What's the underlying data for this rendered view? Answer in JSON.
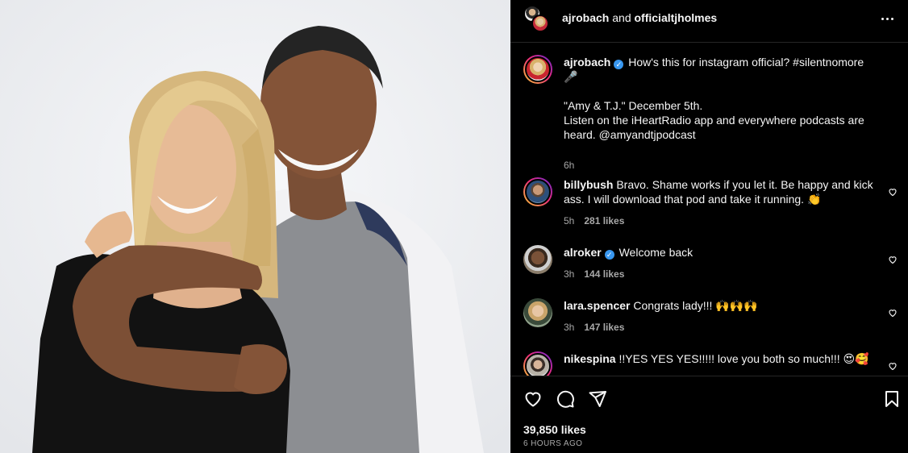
{
  "header": {
    "user1": "ajrobach",
    "conjunction": "and",
    "user2": "officialtjholmes"
  },
  "caption": {
    "username": "ajrobach",
    "line1": "How's this for instagram official? #silentnomore",
    "emoji": "🎤",
    "line2": "\"Amy & T.J.\" December 5th.",
    "line3": "Listen on the iHeartRadio app and everywhere podcasts are heard. @amyandtjpodcast",
    "time": "6h"
  },
  "comments": [
    {
      "username": "billybush",
      "text": "Bravo. Shame works if you let it. Be happy and kick ass. I will download that pod and take it running. 👏",
      "time": "5h",
      "likes": "281 likes"
    },
    {
      "username": "alroker",
      "text": "Welcome back",
      "time": "3h",
      "likes": "144 likes"
    },
    {
      "username": "lara.spencer",
      "text": "Congrats lady!!! 🙌🙌🙌",
      "time": "3h",
      "likes": "147 likes"
    },
    {
      "username": "nikespina",
      "text": "!!YES YES YES!!!!! love you both so much!!! 😍🥰",
      "time": "",
      "likes": ""
    }
  ],
  "footer": {
    "likes": "39,850 likes",
    "timeago": "6 HOURS AGO"
  },
  "icons": {
    "more": "more-options-icon",
    "like": "heart-icon",
    "comment": "comment-icon",
    "share": "share-icon",
    "save": "bookmark-icon",
    "verified": "verified-badge-icon"
  },
  "colors": {
    "background": "#000000",
    "text": "#f5f5f5",
    "secondary_text": "#a8a8a8",
    "verified": "#3897f0",
    "divider": "#262626"
  }
}
